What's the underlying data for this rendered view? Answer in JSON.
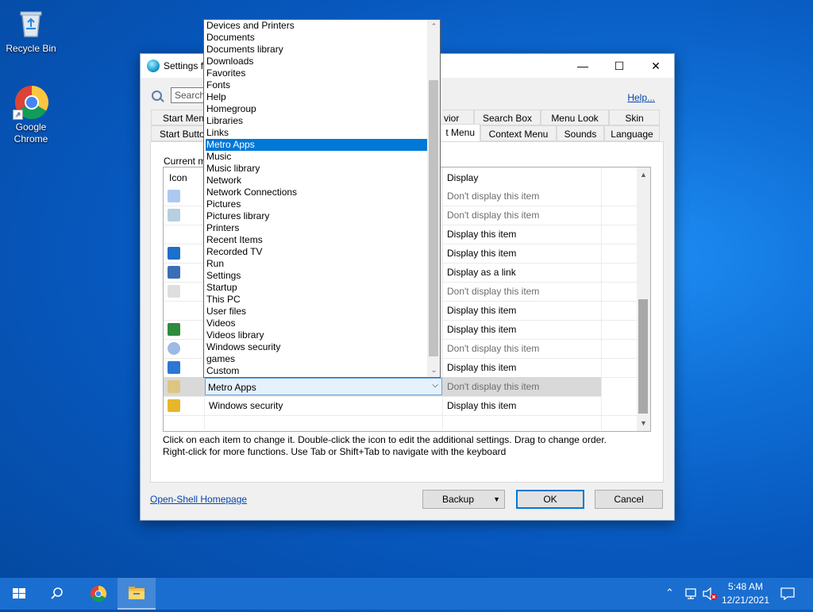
{
  "desktop": {
    "icons": [
      {
        "label": "Recycle Bin"
      },
      {
        "label": "Google Chrome"
      }
    ]
  },
  "window": {
    "title": "Settings f",
    "controls": {
      "minimize": "—",
      "maximize": "☐",
      "close": "✕"
    },
    "search_placeholder": "Search",
    "help_link": "Help...",
    "tabs_row1": [
      "Start Men",
      "vior",
      "Search Box",
      "Menu Look",
      "Skin"
    ],
    "tabs_row2": [
      "Start Butto",
      "t Menu",
      "Context Menu",
      "Sounds",
      "Language"
    ],
    "panel_label": "Current m",
    "grid_header": {
      "icon": "Icon",
      "display": "Display"
    },
    "rows": [
      {
        "display": "Don't display this item",
        "muted": true
      },
      {
        "display": "Don't display this item",
        "muted": true
      },
      {
        "display": "Display this item",
        "muted": false
      },
      {
        "display": "Display this item",
        "muted": false
      },
      {
        "display": "Display as a link",
        "muted": false
      },
      {
        "display": "Don't display this item",
        "muted": true
      },
      {
        "display": "Display this item",
        "muted": false
      },
      {
        "display": "Display this item",
        "muted": false
      },
      {
        "display": "Don't display this item",
        "muted": true
      },
      {
        "display": "Display this item",
        "muted": false
      },
      {
        "display": "Don't display this item",
        "muted": true,
        "selected": true
      },
      {
        "name": "Windows security",
        "display": "Display this item",
        "muted": false
      }
    ],
    "combo_value": "Metro Apps",
    "instructions": [
      "Click on each item to change it. Double-click the icon to edit the additional settings. Drag to change order.",
      "Right-click for more functions. Use Tab or Shift+Tab to navigate with the keyboard"
    ],
    "homepage_link": "Open-Shell Homepage",
    "buttons": {
      "backup": "Backup",
      "ok": "OK",
      "cancel": "Cancel"
    }
  },
  "dropdown": {
    "items": [
      "Devices and Printers",
      "Documents",
      "Documents library",
      "Downloads",
      "Favorites",
      "Fonts",
      "Help",
      "Homegroup",
      "Libraries",
      "Links",
      "Metro Apps",
      "Music",
      "Music library",
      "Network",
      "Network Connections",
      "Pictures",
      "Pictures library",
      "Printers",
      "Recent Items",
      "Recorded TV",
      "Run",
      "Settings",
      "Startup",
      "This PC",
      "User files",
      "Videos",
      "Videos library",
      "Windows security",
      "games",
      "Custom"
    ],
    "highlighted": "Metro Apps"
  },
  "taskbar": {
    "time": "5:48 AM",
    "date": "12/21/2021"
  },
  "colors": {
    "accent": "#0078d7",
    "taskbar": "#1a6ed0",
    "link": "#0645ad"
  }
}
